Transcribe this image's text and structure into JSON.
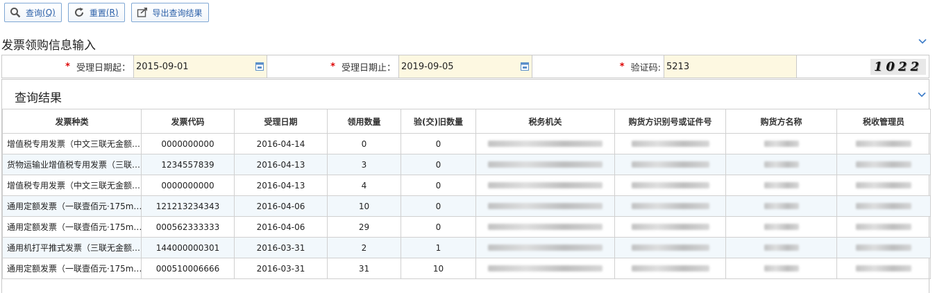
{
  "toolbar": {
    "query_label": "查询",
    "query_key": "(Q)",
    "reset_label": "重置",
    "reset_key": "(R)",
    "export_label": "导出查询结果"
  },
  "input_section": {
    "title": "发票领购信息输入",
    "start_date_label": "受理日期起：",
    "start_date_value": "2015-09-01",
    "end_date_label": "受理日期止：",
    "end_date_value": "2019-09-05",
    "code_label": "验证码:",
    "code_value": "5213",
    "captcha_text": "1022",
    "required_mark": "*"
  },
  "results": {
    "title": "查询结果",
    "columns": [
      "发票种类",
      "发票代码",
      "受理日期",
      "领用数量",
      "验(交)旧数量",
      "税务机关",
      "购货方识别号或证件号",
      "购货方名称",
      "税收管理员"
    ],
    "rows": [
      {
        "type": "增值税专用发票（中文三联无金额…",
        "code": "0000000000",
        "date": "2016-04-14",
        "qty": "0",
        "old_qty": "0"
      },
      {
        "type": "货物运输业增值税专用发票（三联…",
        "code": "1234557839",
        "date": "2016-04-13",
        "qty": "3",
        "old_qty": "0"
      },
      {
        "type": "增值税专用发票（中文三联无金额…",
        "code": "0000000000",
        "date": "2016-04-13",
        "qty": "4",
        "old_qty": "0"
      },
      {
        "type": "通用定额发票（一联壹佰元·175m…",
        "code": "121213234343",
        "date": "2016-04-06",
        "qty": "10",
        "old_qty": "0"
      },
      {
        "type": "通用定额发票（一联壹佰元·175m…",
        "code": "000562333333",
        "date": "2016-04-06",
        "qty": "29",
        "old_qty": "0"
      },
      {
        "type": "通用机打平推式发票（三联无金额…",
        "code": "144000000301",
        "date": "2016-03-31",
        "qty": "2",
        "old_qty": "1"
      },
      {
        "type": "通用定额发票（一联壹佰元·175m…",
        "code": "000510006666",
        "date": "2016-03-31",
        "qty": "31",
        "old_qty": "10"
      }
    ]
  },
  "colors": {
    "accent": "#2a5fa8",
    "required": "#dd0000",
    "input_bg": "#fdf8e1",
    "alt_row": "#f2f8fc"
  }
}
